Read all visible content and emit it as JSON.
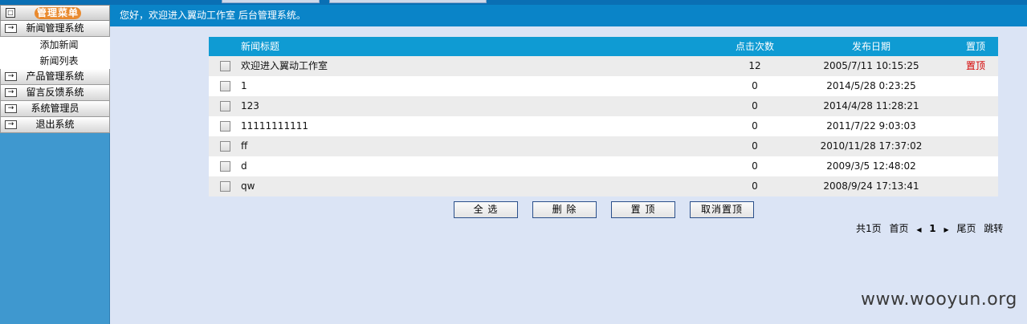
{
  "sidebar": {
    "menu_title": "管理菜单",
    "groups": [
      {
        "label": "新闻管理系统",
        "subitems": [
          "添加新闻",
          "新闻列表"
        ]
      },
      {
        "label": "产品管理系统"
      },
      {
        "label": "留言反馈系统"
      },
      {
        "label": "系统管理员"
      },
      {
        "label": "退出系统"
      }
    ]
  },
  "header": {
    "welcome": "您好，欢迎进入翼动工作室 后台管理系统。"
  },
  "table": {
    "columns": {
      "title": "新闻标题",
      "clicks": "点击次数",
      "date": "发布日期",
      "top": "置顶"
    },
    "rows": [
      {
        "title": "欢迎进入翼动工作室",
        "clicks": "12",
        "date": "2005/7/11 10:15:25",
        "top": "置顶"
      },
      {
        "title": "1",
        "clicks": "0",
        "date": "2014/5/28 0:23:25",
        "top": ""
      },
      {
        "title": "123",
        "clicks": "0",
        "date": "2014/4/28 11:28:21",
        "top": ""
      },
      {
        "title": "11111111111",
        "clicks": "0",
        "date": "2011/7/22 9:03:03",
        "top": ""
      },
      {
        "title": "ff",
        "clicks": "0",
        "date": "2010/11/28 17:37:02",
        "top": ""
      },
      {
        "title": "d",
        "clicks": "0",
        "date": "2009/3/5 12:48:02",
        "top": ""
      },
      {
        "title": "qw",
        "clicks": "0",
        "date": "2008/9/24 17:13:41",
        "top": ""
      }
    ]
  },
  "actions": {
    "select_all": "全 选",
    "delete": "删 除",
    "set_top": "置 顶",
    "cancel_top": "取消置顶"
  },
  "pager": {
    "total": "共1页",
    "first": "首页",
    "current": "1",
    "last": "尾页",
    "jump": "跳转"
  },
  "watermark": "www.wooyun.org",
  "colors": {
    "header_bg": "#0a84c8",
    "sidebar_bg": "#3f98cf",
    "table_head_bg": "#0f9bd3",
    "page_bg": "#dbe4f5",
    "top_label": "#d40000"
  }
}
